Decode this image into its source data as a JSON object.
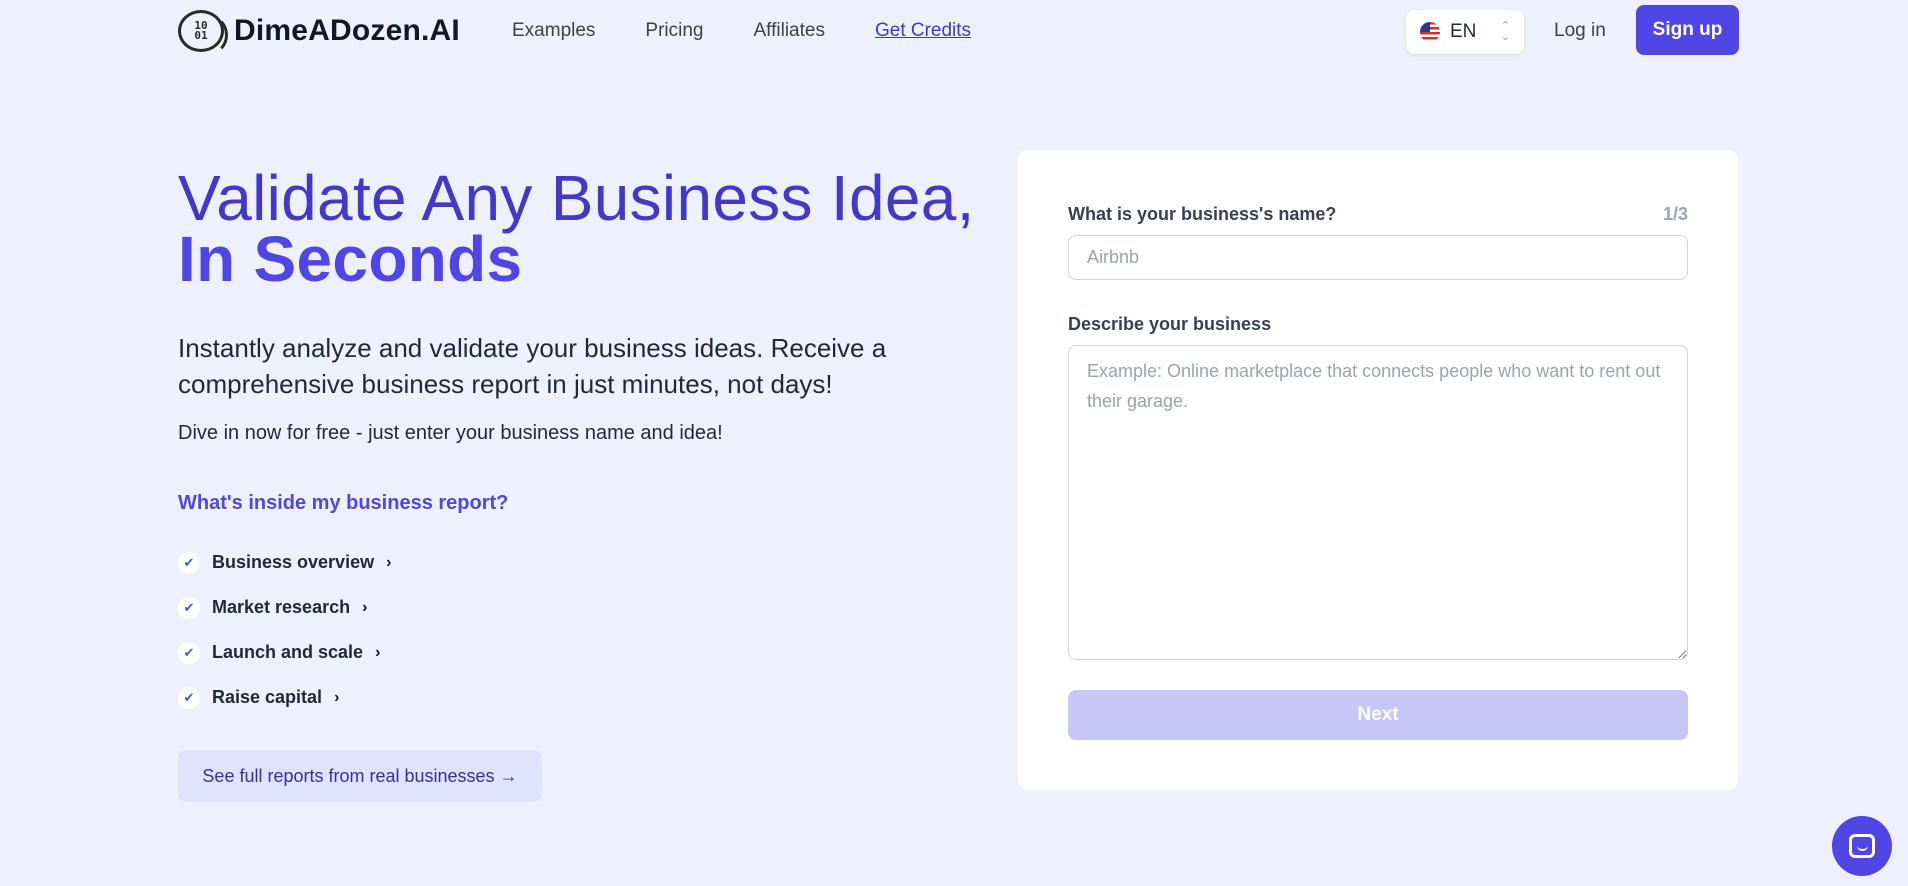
{
  "brand": {
    "name": "DimeADozen.AI",
    "logo_text": "10\n01"
  },
  "nav": {
    "items": [
      {
        "label": "Examples"
      },
      {
        "label": "Pricing"
      },
      {
        "label": "Affiliates"
      },
      {
        "label": "Get Credits"
      }
    ]
  },
  "language": {
    "code": "EN",
    "icon": "us-flag-icon"
  },
  "auth": {
    "login_label": "Log in",
    "signup_label": "Sign up"
  },
  "hero": {
    "title_regular": "Validate Any Business Idea, ",
    "title_bold": "In Seconds",
    "subtitle": "Instantly analyze and validate your business ideas. Receive a comprehensive business report in just minutes, not days!",
    "cta_text": "Dive in now for free - just enter your business name and idea!",
    "inside_heading": "What's inside my business report?",
    "report_items": [
      {
        "label": "Business overview"
      },
      {
        "label": "Market research"
      },
      {
        "label": "Launch and scale"
      },
      {
        "label": "Raise capital"
      }
    ],
    "reports_link": "See full reports from real businesses →"
  },
  "form": {
    "name_label": "What is your business's name?",
    "step": "1/3",
    "name_placeholder": "Airbnb",
    "name_value": "",
    "desc_label": "Describe your business",
    "desc_placeholder": "Example: Online marketplace that connects people who want to rent out their garage.",
    "desc_value": "",
    "next_label": "Next"
  },
  "colors": {
    "background": "#eef1fd",
    "accent": "#4f46e5",
    "accent_dark": "#4338ca",
    "next_disabled": "#c7c6f5"
  }
}
